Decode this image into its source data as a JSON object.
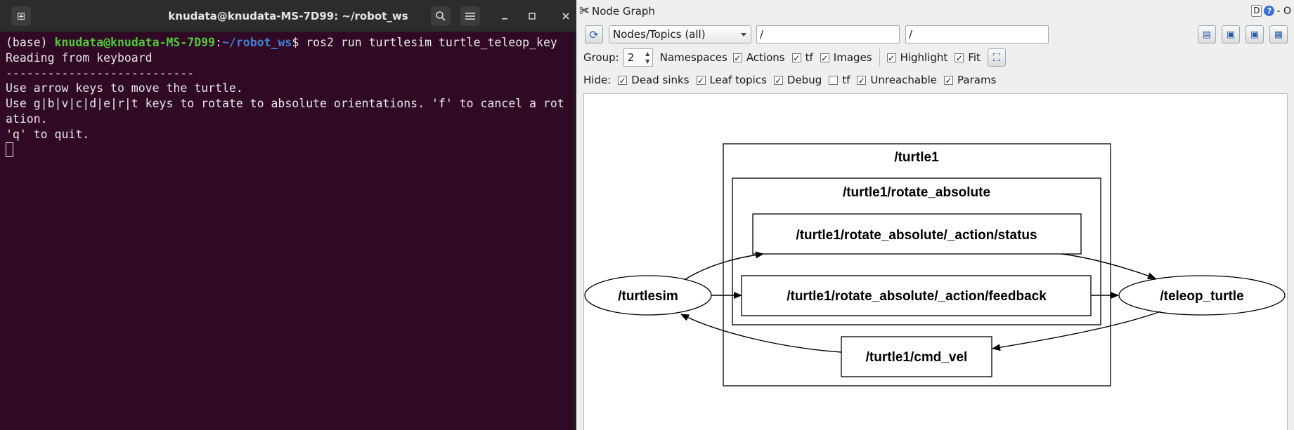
{
  "terminal": {
    "title": "knudata@knudata-MS-7D99: ~/robot_ws",
    "prompt_env": "(base) ",
    "prompt_user": "knudata@knudata-MS-7D99",
    "prompt_sep": ":",
    "prompt_path": "~/robot_ws",
    "prompt_end": "$ ",
    "command": "ros2 run turtlesim turtle_teleop_key",
    "output": [
      "Reading from keyboard",
      "---------------------------",
      "Use arrow keys to move the turtle.",
      "Use g|b|v|c|d|e|r|t keys to rotate to absolute orientations. 'f' to cancel a rot",
      "ation.",
      "'q' to quit."
    ]
  },
  "node_graph": {
    "title": "Node Graph",
    "title_right_badge": "D",
    "title_right_help": "?",
    "title_right_trail": "- O",
    "toolbar": {
      "mode": "Nodes/Topics (all)",
      "filter1": "/",
      "filter2": "/"
    },
    "options": {
      "group_label": "Group:",
      "group_value": "2",
      "namespaces": "Namespaces",
      "actions": "Actions",
      "tf": "tf",
      "images": "Images",
      "highlight": "Highlight",
      "fit": "Fit"
    },
    "hide": {
      "label": "Hide:",
      "dead_sinks": "Dead sinks",
      "leaf_topics": "Leaf topics",
      "debug": "Debug",
      "tf": "tf",
      "unreachable": "Unreachable",
      "params": "Params"
    },
    "graph": {
      "ns_outer": "/turtle1",
      "ns_inner": "/turtle1/rotate_absolute",
      "topic_status": "/turtle1/rotate_absolute/_action/status",
      "topic_feedback": "/turtle1/rotate_absolute/_action/feedback",
      "topic_cmd_vel": "/turtle1/cmd_vel",
      "node_turtlesim": "/turtlesim",
      "node_teleop": "/teleop_turtle"
    }
  }
}
